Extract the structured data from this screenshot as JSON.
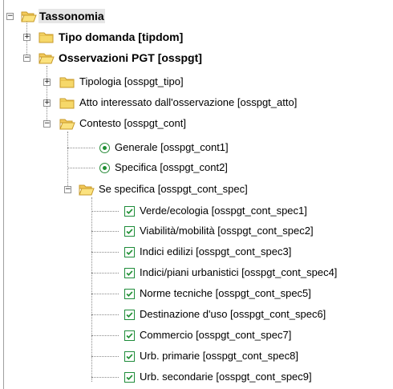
{
  "tree": {
    "root": {
      "label": "Tassonomia",
      "expanded": true,
      "expander_symbol": "−"
    },
    "items": [
      {
        "id": "tipdom",
        "label": "Tipo domanda [tipdom]",
        "expanded": false,
        "expander_symbol": "+"
      },
      {
        "id": "osspgt",
        "label": "Osservazioni PGT [osspgt]",
        "expanded": true,
        "expander_symbol": "−",
        "children": [
          {
            "id": "osspgt_tipo",
            "label": "Tipologia [osspgt_tipo]",
            "expander_symbol": "+"
          },
          {
            "id": "osspgt_atto",
            "label": "Atto interessato dall'osservazione [osspgt_atto]",
            "expander_symbol": "+"
          },
          {
            "id": "osspgt_cont",
            "label": "Contesto [osspgt_cont]",
            "expander_symbol": "−",
            "children": [
              {
                "id": "osspgt_cont1",
                "label": "Generale [osspgt_cont1]",
                "type": "radio"
              },
              {
                "id": "osspgt_cont2",
                "label": "Specifica [osspgt_cont2]",
                "type": "radio"
              },
              {
                "id": "osspgt_cont_spec",
                "label": "Se specifica [osspgt_cont_spec]",
                "expander_symbol": "−",
                "children": [
                  {
                    "label": "Verde/ecologia [osspgt_cont_spec1]",
                    "checked": true
                  },
                  {
                    "label": "Viabilità/mobilità [osspgt_cont_spec2]",
                    "checked": true
                  },
                  {
                    "label": "Indici edilizi [osspgt_cont_spec3]",
                    "checked": true
                  },
                  {
                    "label": "Indici/piani urbanistici [osspgt_cont_spec4]",
                    "checked": true
                  },
                  {
                    "label": "Norme tecniche [osspgt_cont_spec5]",
                    "checked": true
                  },
                  {
                    "label": "Destinazione d'uso [osspgt_cont_spec6]",
                    "checked": true
                  },
                  {
                    "label": "Commercio [osspgt_cont_spec7]",
                    "checked": true
                  },
                  {
                    "label": "Urb. primarie [osspgt_cont_spec8]",
                    "checked": true
                  },
                  {
                    "label": "Urb. secondarie [osspgt_cont_spec9]",
                    "checked": true
                  }
                ]
              }
            ]
          }
        ]
      }
    ]
  },
  "colors": {
    "folder_fill": "#f6d86a",
    "folder_edge": "#c79a2a",
    "check_green": "#1f8f33",
    "tree_line": "#8a8a8a"
  },
  "icons": {
    "folder_closed": "folder-closed-icon",
    "folder_open": "folder-open-icon",
    "checkbox": "checkbox-checked-icon",
    "radio": "radio-selected-icon"
  }
}
